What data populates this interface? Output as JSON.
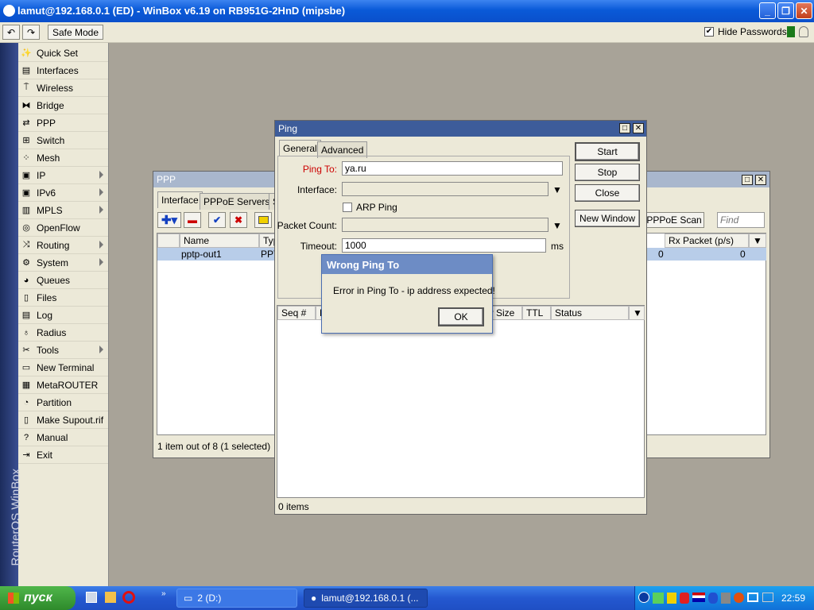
{
  "window": {
    "title": "lamut@192.168.0.1 (ED) - WinBox v6.19 on RB951G-2HnD (mipsbe)"
  },
  "toolbar": {
    "safe_mode": "Safe Mode",
    "hide_passwords": "Hide Passwords"
  },
  "sidebar": {
    "brand": "RouterOS WinBox",
    "items": [
      {
        "label": "Quick Set",
        "icon": "wand-icon",
        "submenu": false
      },
      {
        "label": "Interfaces",
        "icon": "interfaces-icon",
        "submenu": false
      },
      {
        "label": "Wireless",
        "icon": "wireless-icon",
        "submenu": false
      },
      {
        "label": "Bridge",
        "icon": "bridge-icon",
        "submenu": false
      },
      {
        "label": "PPP",
        "icon": "ppp-icon",
        "submenu": false
      },
      {
        "label": "Switch",
        "icon": "switch-icon",
        "submenu": false
      },
      {
        "label": "Mesh",
        "icon": "mesh-icon",
        "submenu": false
      },
      {
        "label": "IP",
        "icon": "ip-icon",
        "submenu": true
      },
      {
        "label": "IPv6",
        "icon": "ipv6-icon",
        "submenu": true
      },
      {
        "label": "MPLS",
        "icon": "mpls-icon",
        "submenu": true
      },
      {
        "label": "OpenFlow",
        "icon": "openflow-icon",
        "submenu": false
      },
      {
        "label": "Routing",
        "icon": "routing-icon",
        "submenu": true
      },
      {
        "label": "System",
        "icon": "gear-icon",
        "submenu": true
      },
      {
        "label": "Queues",
        "icon": "queues-icon",
        "submenu": false
      },
      {
        "label": "Files",
        "icon": "files-icon",
        "submenu": false
      },
      {
        "label": "Log",
        "icon": "log-icon",
        "submenu": false
      },
      {
        "label": "Radius",
        "icon": "radius-icon",
        "submenu": false
      },
      {
        "label": "Tools",
        "icon": "tools-icon",
        "submenu": true
      },
      {
        "label": "New Terminal",
        "icon": "terminal-icon",
        "submenu": false
      },
      {
        "label": "MetaROUTER",
        "icon": "metarouter-icon",
        "submenu": false
      },
      {
        "label": "Partition",
        "icon": "partition-icon",
        "submenu": false
      },
      {
        "label": "Make Supout.rif",
        "icon": "supout-icon",
        "submenu": false
      },
      {
        "label": "Manual",
        "icon": "help-icon",
        "submenu": false
      },
      {
        "label": "Exit",
        "icon": "exit-icon",
        "submenu": false
      }
    ]
  },
  "ppp": {
    "title": "PPP",
    "tabs": [
      "Interface",
      "PPPoE Servers",
      "S"
    ],
    "pppoe_scan": "PPPoE Scan",
    "find_placeholder": "Find",
    "columns": {
      "name": "Name",
      "type": "Typ",
      "rx_packet": "Rx Packet (p/s)"
    },
    "row": {
      "name": "pptp-out1",
      "type": "PPT",
      "rx_a": "0",
      "rx_b": "0"
    },
    "status": "1 item out of 8 (1 selected)"
  },
  "ping": {
    "title": "Ping",
    "tabs": [
      "General",
      "Advanced"
    ],
    "labels": {
      "ping_to": "Ping To:",
      "interface": "Interface:",
      "arp_ping": "ARP Ping",
      "packet_count": "Packet Count:",
      "timeout": "Timeout:",
      "ms": "ms"
    },
    "values": {
      "ping_to": "ya.ru",
      "timeout": "1000"
    },
    "buttons": {
      "start": "Start",
      "stop": "Stop",
      "close": "Close",
      "new_window": "New Window"
    },
    "columns": {
      "seq": "Seq #",
      "h": "H",
      "size": "ly Size",
      "ttl": "TTL",
      "status": "Status"
    },
    "status": "0 items"
  },
  "error": {
    "title": "Wrong Ping To",
    "message": "Error in Ping To - ip address expected!",
    "ok": "OK"
  },
  "taskbar": {
    "start": "пуск",
    "task1": "2 (D:)",
    "task2": "lamut@192.168.0.1 (...",
    "clock": "22:59"
  }
}
